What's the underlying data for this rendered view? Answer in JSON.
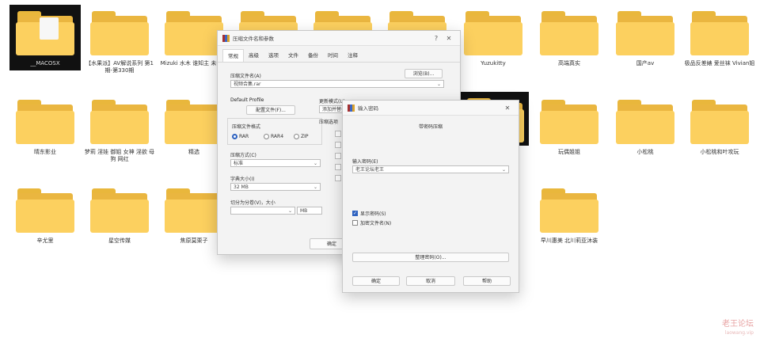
{
  "folders": [
    {
      "label": "__MACOSX"
    },
    {
      "label": "【水果派】AV解说系列 第1期-第330期"
    },
    {
      "label": "Mizuki 水木 谁知主 未奈明"
    },
    {
      "label": "..."
    },
    {
      "label": "..."
    },
    {
      "label": "..."
    },
    {
      "label": "Yuzukitty"
    },
    {
      "label": "高端真实"
    },
    {
      "label": "国产av"
    },
    {
      "label": "极品反差婊 爱丝袜 Vivian姐"
    },
    {
      "label": "晴东影业"
    },
    {
      "label": "梦莉 淫娃 御姐 女神 淫欲 母狗 网红"
    },
    {
      "label": "精选"
    },
    {
      "label": "玩偶姐姐"
    },
    {
      "label": "小松桃"
    },
    {
      "label": "小松桃和叶攻玩"
    },
    {
      "label": "辛尤里"
    },
    {
      "label": "星空传媒"
    },
    {
      "label": "焦原莫栗子"
    },
    {
      "label": "早川惠美 北川莉亚沐装"
    }
  ],
  "archive_dialog": {
    "title": "压缩文件名和参数",
    "help": "?",
    "close": "✕",
    "tabs": [
      "常规",
      "高级",
      "选项",
      "文件",
      "备份",
      "时间",
      "注释"
    ],
    "archive_name_label": "压缩文件名(A)",
    "browse_button": "浏览(B)...",
    "archive_name_value": "视频合集.rar",
    "default_profile_label": "Default Profile",
    "profiles_button": "配置文件(F)...",
    "update_mode_label": "更新模式(U)",
    "update_mode_value": "添加并替换文件",
    "format_label": "压缩文件格式",
    "formats": [
      "RAR",
      "RAR4",
      "ZIP"
    ],
    "selected_format": "RAR",
    "method_label": "压缩方式(C)",
    "method_value": "标准",
    "dict_label": "字典大小(I)",
    "dict_value": "32 MB",
    "split_label": "切分为分卷(V)，大小",
    "split_unit": "MB",
    "options_label": "压缩选项",
    "ok_button": "确定"
  },
  "password_dialog": {
    "title": "输入密码",
    "close": "✕",
    "header": "带密码压缩",
    "enter_label": "输入密码(E)",
    "password_value": "老王论坛老王",
    "show_password": "显示密码(S)",
    "encrypt_names": "加密文件名(N)",
    "organize_button": "整理密码(O)...",
    "ok_button": "确定",
    "cancel_button": "取消",
    "help_button": "帮助"
  },
  "watermark": {
    "text": "老王论坛",
    "url": "laowang.vip"
  }
}
